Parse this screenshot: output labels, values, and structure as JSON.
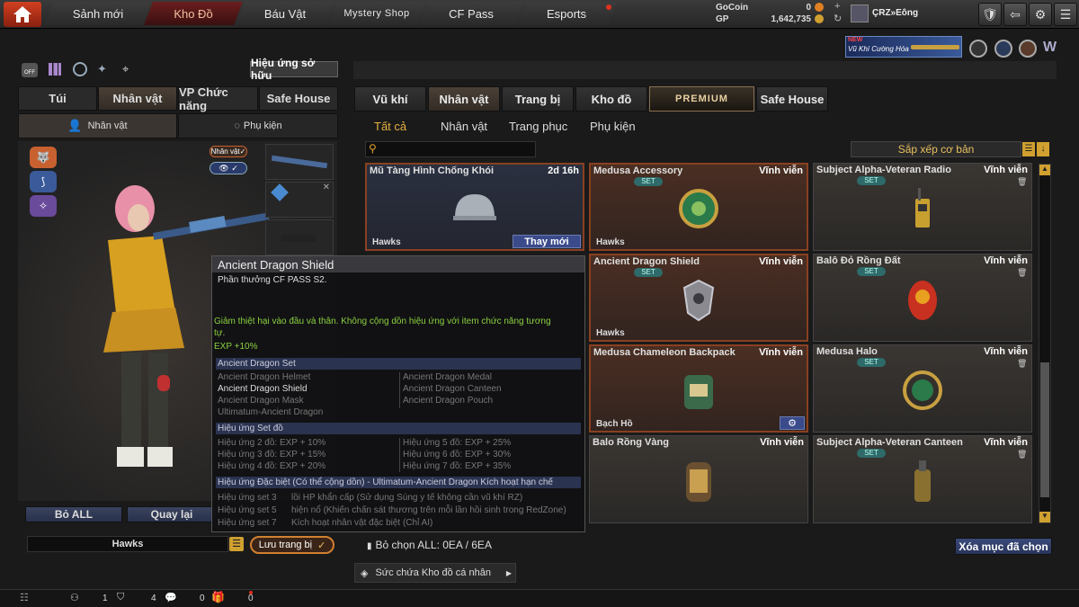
{
  "nav": {
    "tabs": [
      "Sảnh mới",
      "Kho Đồ",
      "Báu Vật",
      "Mystery Shop",
      "CF Pass",
      "Esports"
    ],
    "gocoin_label": "GoCoin",
    "gocoin_value": "0",
    "gp_label": "GP",
    "gp_value": "1,642,735",
    "username": "ÇRZ»Eông"
  },
  "banner": {
    "new": "NEW",
    "title": "Vũ Khí Cường Hóa"
  },
  "left": {
    "effect_button": "Hiệu ứng sở hữu",
    "tabs": [
      "Túi",
      "Nhân vật",
      "VP Chức năng",
      "Safe House"
    ],
    "subtabs": [
      "Nhân vật",
      "Phụ kiện"
    ],
    "badge": "Nhân vật",
    "reset_all": "Bỏ ALL",
    "back": "Quay lại",
    "preset_name": "Hawks",
    "save_button": "Lưu trang bị"
  },
  "right": {
    "tabs": [
      "Vũ khí",
      "Nhân vật",
      "Trang bị",
      "Kho đồ",
      "PREMIUM",
      "Safe House"
    ],
    "filters": [
      "Tất cả",
      "Nhân vật",
      "Trang phục",
      "Phụ kiện"
    ],
    "sort_label": "Sắp xếp cơ bản",
    "search_placeholder": "",
    "deselect": "Bỏ chọn ALL: 0EA / 6EA",
    "clear_button": "Xóa mục đã chọn",
    "capacity": "Sức chứa Kho đồ cá nhân"
  },
  "cards": [
    {
      "name": "Mũ Tàng Hình Chống Khói",
      "duration": "2d 16h",
      "owner": "Hawks",
      "set": false,
      "action": "Thay mới"
    },
    {
      "name": "Medusa Accessory",
      "duration": "Vĩnh viễn",
      "owner": "Hawks",
      "set": true
    },
    {
      "name": "Subject Alpha-Veteran Radio",
      "duration": "Vĩnh viễn",
      "owner": "",
      "set": true
    },
    {
      "name": "Ancient Dragon Shield",
      "duration": "Vĩnh viễn",
      "owner": "Hawks",
      "set": true
    },
    {
      "name": "Balô Đỏ Rồng Đất",
      "duration": "Vĩnh viễn",
      "owner": "",
      "set": true
    },
    {
      "name": "Medusa Chameleon Backpack",
      "duration": "Vĩnh viễn",
      "owner": "Bạch Hồ",
      "set": false
    },
    {
      "name": "Medusa Halo",
      "duration": "Vĩnh viễn",
      "owner": "",
      "set": true
    },
    {
      "name": "Balo Rồng Vàng",
      "duration": "Vĩnh viễn",
      "owner": "",
      "set": false
    },
    {
      "name": "Subject Alpha-Veteran Canteen",
      "duration": "Vĩnh viễn",
      "owner": "",
      "set": true
    }
  ],
  "set_label": "SET",
  "tooltip": {
    "title": "Ancient Dragon Shield",
    "subtitle": "Phần thưởng CF PASS S2.",
    "desc1": "Giảm thiệt hại vào đầu và thân. Không cộng dồn hiệu ứng với item chức năng tương",
    "desc2": "tự.",
    "exp": "EXP +10%",
    "set_header": "Ancient Dragon Set",
    "set_left": [
      "Ancient Dragon Helmet",
      "Ancient Dragon Shield",
      "Ancient Dragon Mask",
      "Ultimatum-Ancient Dragon"
    ],
    "set_right": [
      "Ancient Dragon Medal",
      "Ancient Dragon Canteen",
      "Ancient Dragon Pouch"
    ],
    "effect_header": "Hiệu ứng Set đồ",
    "effect_left": [
      "Hiệu ứng 2 đồ: EXP + 10%",
      "Hiệu ứng 3 đồ: EXP + 15%",
      "Hiệu ứng 4 đồ: EXP + 20%"
    ],
    "effect_right": [
      "Hiệu ứng 5 đồ: EXP + 25%",
      "Hiệu ứng 6 đồ: EXP + 30%",
      "Hiệu ứng 7 đồ: EXP + 35%"
    ],
    "special_header": "Hiệu ứng Đặc biệt (Có thể cộng dồn) - Ultimatum-Ancient Dragon Kích hoạt hạn chế",
    "special_rows": [
      {
        "k": "Hiệu ứng set 3",
        "v": "lồi HP khẩn cấp (Sử dụng Súng y tế không cần vũ khí RZ)"
      },
      {
        "k": "Hiệu ứng set 5",
        "v": "hiện nổ (Khiến chấn sát thương trên mỗi lần hồi sinh trong RedZone)"
      },
      {
        "k": "Hiệu ứng set 7",
        "v": "Kích hoạt nhân vật đặc biệt (Chỉ AI)"
      }
    ]
  },
  "bottom": {
    "c1": "1",
    "c2": "4",
    "c3": "0",
    "c4": "0"
  }
}
